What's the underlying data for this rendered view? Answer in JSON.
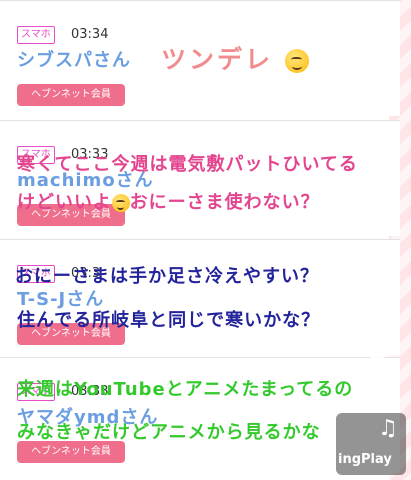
{
  "posts": [
    {
      "tag": "スマホ",
      "time": "03:34",
      "username": "シブスパさん",
      "button": "ヘブンネット会員"
    },
    {
      "tag": "スマホ",
      "time": "03:33",
      "username": "machimoさん",
      "button": "ヘブンネット会員"
    },
    {
      "tag": "スマホ",
      "time": "03:3",
      "username": "T-S-Jさん",
      "button": "ヘブンネット会員"
    },
    {
      "tag": "スマホ",
      "time": "03:33",
      "username": "ヤマダymdさん",
      "button": "ヘブンネット会員"
    }
  ],
  "overlays": {
    "title": "ツンデレ",
    "pink_line1": "寒くてここ今週は電気敷パットひいてる",
    "pink_line2a": "けどいいよ",
    "pink_line2b": "おにーさま使わない？",
    "navy_line1": "おにーさまは手か足さ冷えやすい？",
    "navy_line2": "住んでる所岐阜と同じで寒いかな？",
    "green_line1": "来週はYouTubeとアニメたまってるの",
    "green_line2": "みなきゃだけどアニメから見るかな",
    "green_note": "♪"
  },
  "watermark": {
    "label": "ingPlay",
    "note": "♫"
  },
  "colors": {
    "tag": "#e94cc8",
    "username": "#6a9ee0",
    "member_button": "#ef6e8b",
    "title_overlay": "#f28c8c",
    "pink_overlay": "#e3458f",
    "navy_overlay": "#23239b",
    "green_overlay": "#34c92c"
  }
}
